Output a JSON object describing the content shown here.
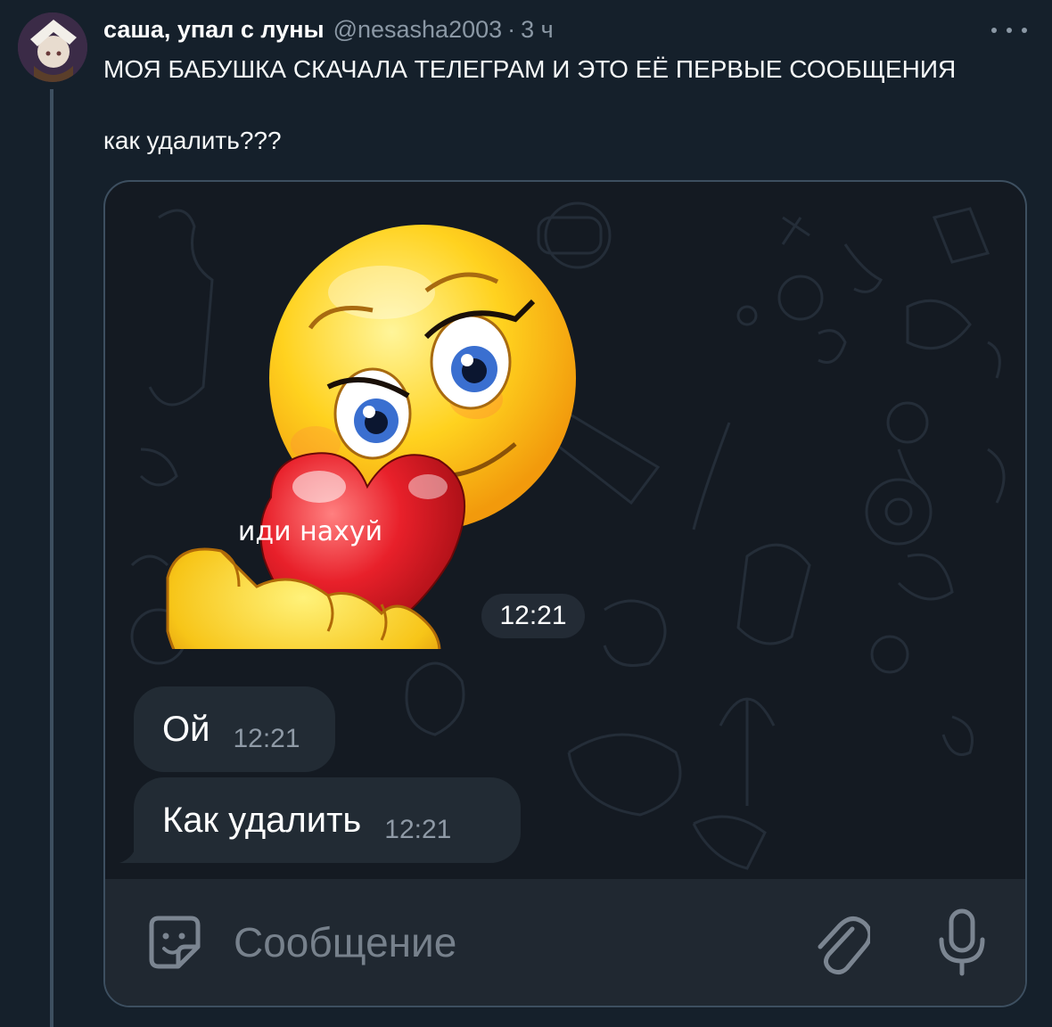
{
  "author": {
    "display_name": "саша, упал с луны",
    "handle": "@nesasha2003",
    "separator": "·",
    "time_ago": "3 ч"
  },
  "tweet": {
    "line1": "МОЯ БАБУШКА СКАЧАЛА ТЕЛЕГРАМ И ЭТО ЕЁ ПЕРВЫЕ СООБЩЕНИЯ",
    "line2": "как удалить???"
  },
  "chat": {
    "sticker_caption": "иди нахуй",
    "sticker_time": "12:21",
    "messages": [
      {
        "text": "Ой",
        "time": "12:21"
      },
      {
        "text": "Как удалить",
        "time": "12:21"
      }
    ],
    "input_placeholder": "Сообщение"
  },
  "icons": {
    "more": "more-icon",
    "sticker": "sticker-icon",
    "attach": "paperclip-icon",
    "mic": "microphone-icon"
  },
  "colors": {
    "background": "#15202b",
    "chat_bubble": "#222b34",
    "input_bar": "#202831",
    "secondary_text": "#8b98a5"
  }
}
